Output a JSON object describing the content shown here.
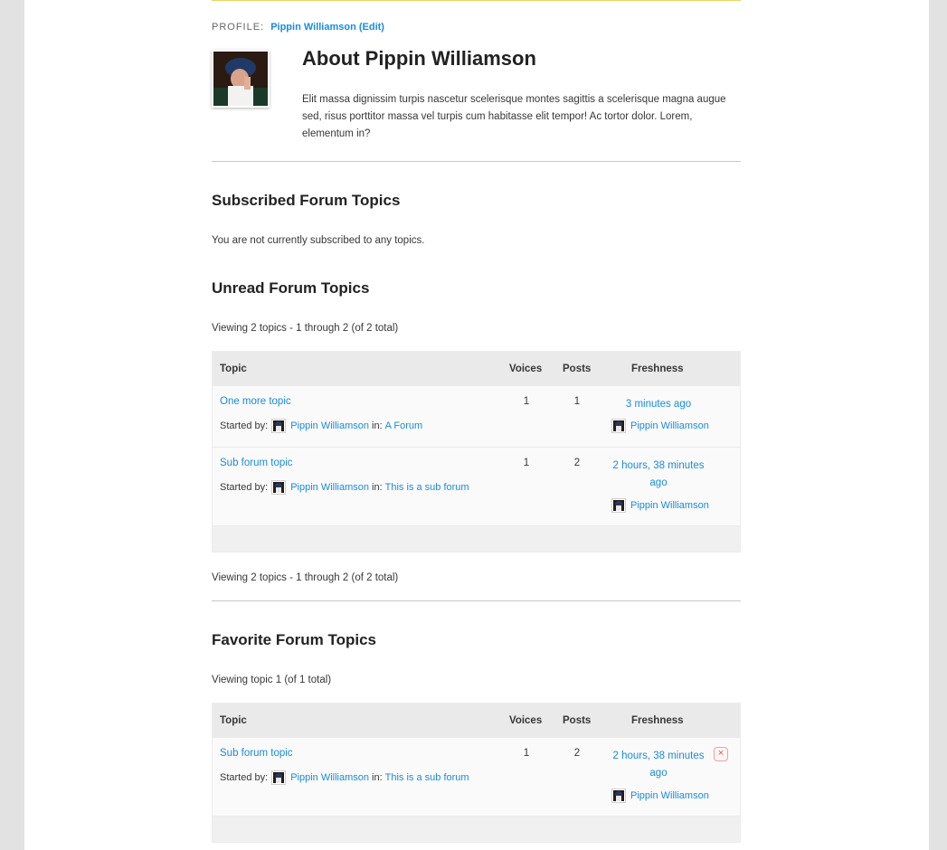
{
  "profile": {
    "label": "Profile:",
    "link": "Pippin Williamson (Edit)"
  },
  "about": {
    "title": "About Pippin Williamson",
    "bio": "Elit massa dignissim turpis nascetur scelerisque montes sagittis a scelerisque magna augue sed, risus porttitor massa vel turpis cum habitasse elit tempor! Ac tortor dolor. Lorem, elementum in?"
  },
  "subscribed": {
    "heading": "Subscribed Forum Topics",
    "empty": "You are not currently subscribed to any topics."
  },
  "columns": {
    "topic": "Topic",
    "voices": "Voices",
    "posts": "Posts",
    "freshness": "Freshness"
  },
  "started_by": "Started by:",
  "in_label": "in:",
  "unread": {
    "heading": "Unread Forum Topics",
    "pagination_top": "Viewing 2 topics - 1 through 2 (of 2 total)",
    "pagination_bottom": "Viewing 2 topics - 1 through 2 (of 2 total)",
    "topics": [
      {
        "title": "One more topic",
        "author": "Pippin Williamson",
        "forum": "A Forum",
        "voices": "1",
        "posts": "1",
        "freshness": "3 minutes ago",
        "last_user": "Pippin Williamson"
      },
      {
        "title": "Sub forum topic",
        "author": "Pippin Williamson",
        "forum": "This is a sub forum",
        "voices": "1",
        "posts": "2",
        "freshness": "2 hours, 38 minutes ago",
        "last_user": "Pippin Williamson"
      }
    ]
  },
  "favorites": {
    "heading": "Favorite Forum Topics",
    "pagination_top": "Viewing topic 1 (of 1 total)",
    "topics": [
      {
        "title": "Sub forum topic",
        "author": "Pippin Williamson",
        "forum": "This is a sub forum",
        "voices": "1",
        "posts": "2",
        "freshness": "2 hours, 38 minutes ago",
        "last_user": "Pippin Williamson",
        "remove": "×"
      }
    ]
  },
  "colors": {
    "link": "#1b8be0",
    "page_bg": "#e2e2e2",
    "header_bg": "#eaeaea"
  }
}
